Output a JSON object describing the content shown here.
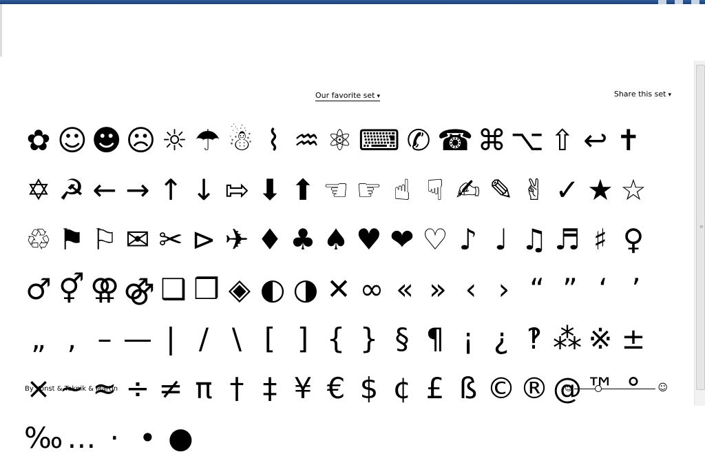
{
  "toolbar": {
    "set_label": "Our favorite set",
    "share_label": "Share this set",
    "caret": "▾"
  },
  "glyphs": [
    "✿",
    "☺",
    "☻",
    "☹",
    "☼",
    "☂",
    "☃",
    "⌇",
    "♒",
    "⚛",
    "⌨",
    "✆",
    "☎",
    "⌘",
    "⌥",
    "⇧",
    "↩",
    "✝",
    "✡",
    "☭",
    "←",
    "→",
    "↑",
    "↓",
    "⇰",
    "⬇",
    "⬆",
    "☜",
    "☞",
    "☝",
    "☟",
    "✍",
    "✎",
    "✌",
    "✓",
    "★",
    "☆",
    "♲",
    "⚑",
    "⚐",
    "✉",
    "✂",
    "⊳",
    "✈",
    "♦",
    "♣",
    "♠",
    "♥",
    "❤",
    "♡",
    "♪",
    "♩",
    "♫",
    "♬",
    "♯",
    "♀",
    "♂",
    "⚥",
    "⚢",
    "⚣",
    "❑",
    "❒",
    "◈",
    "◐",
    "◑",
    "✕",
    "∞",
    "«",
    "»",
    "‹",
    "›",
    "“",
    "”",
    "‘",
    "’",
    "„",
    "‚",
    "–",
    "—",
    "|",
    "/",
    "\\",
    "[",
    "]",
    "{",
    "}",
    "§",
    "¶",
    "¡",
    "¿",
    "‽",
    "⁂",
    "※",
    "±",
    "×",
    "~",
    "≈",
    "÷",
    "≠",
    "π",
    "†",
    "‡",
    "¥",
    "€",
    "$",
    "¢",
    "£",
    "ß",
    "©",
    "®",
    "@",
    "™",
    "°",
    "‰",
    "…",
    "·",
    "•",
    "●"
  ],
  "footer": {
    "credit": "By Konst & Teknik & Martin"
  },
  "zoom": {
    "small_icon": "☺",
    "large_icon": "☺",
    "level": 0.3
  }
}
